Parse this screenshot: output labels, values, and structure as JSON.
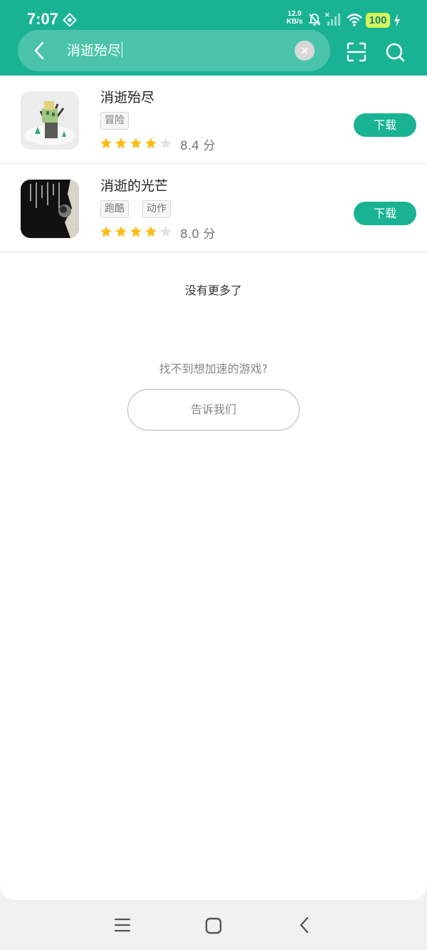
{
  "status_bar": {
    "time": "7:07",
    "net_speed_value": "12.9",
    "net_speed_unit": "KB/s",
    "battery": "100",
    "icons": [
      "sim-icon",
      "bell-muted-icon",
      "signal-icon",
      "wifi-icon",
      "battery-icon",
      "charging-bolt-icon"
    ]
  },
  "search": {
    "query": "消逝殆尽",
    "icons": [
      "back-arrow-icon",
      "clear-icon",
      "scan-icon",
      "search-icon"
    ]
  },
  "results": [
    {
      "name": "消逝殆尽",
      "tags": [
        "冒险"
      ],
      "rating_stars": 4,
      "score": "8.4 分",
      "action": "下载"
    },
    {
      "name": "消逝的光芒",
      "tags": [
        "跑酷",
        "动作"
      ],
      "rating_stars": 4,
      "score": "8.0 分",
      "action": "下载"
    }
  ],
  "footer": {
    "no_more": "没有更多了",
    "prompt": "找不到想加速的游戏?",
    "tell_us": "告诉我们"
  },
  "colors": {
    "brand": "#19b394",
    "star": "#fbbd12",
    "star_empty": "#e3e3e3"
  },
  "nav_bar": {
    "icons": [
      "menu-icon",
      "home-icon",
      "back-icon"
    ]
  }
}
